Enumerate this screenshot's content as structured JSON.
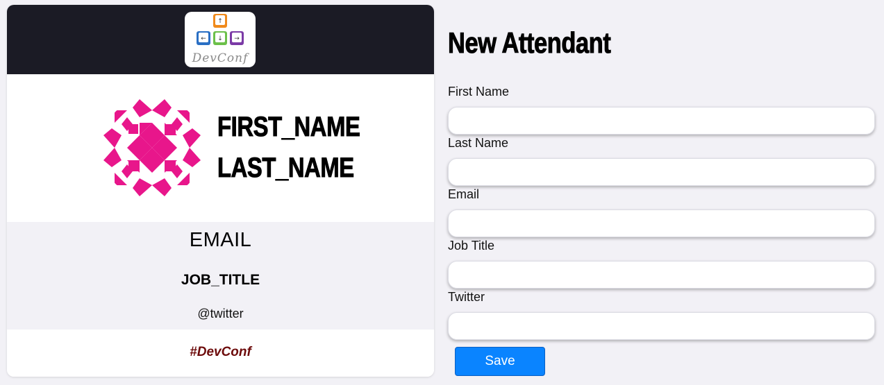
{
  "badge": {
    "logo_text": "DevConf",
    "first_name": "FIRST_NAME",
    "last_name": "LAST_NAME",
    "email": "EMAIL",
    "job_title": "JOB_TITLE",
    "twitter": "@twitter",
    "hashtag": "#DevConf",
    "avatar_color": "#e8168b"
  },
  "form": {
    "title": "New Attendant",
    "fields": [
      {
        "label": "First Name",
        "value": ""
      },
      {
        "label": "Last Name",
        "value": ""
      },
      {
        "label": "Email",
        "value": ""
      },
      {
        "label": "Job Title",
        "value": ""
      },
      {
        "label": "Twitter",
        "value": ""
      }
    ],
    "save_label": "Save"
  },
  "colors": {
    "page_bg": "#f2f1f6",
    "header_bg": "#1b1b25",
    "accent": "#0a84ff",
    "hashtag": "#6d0b0b"
  }
}
